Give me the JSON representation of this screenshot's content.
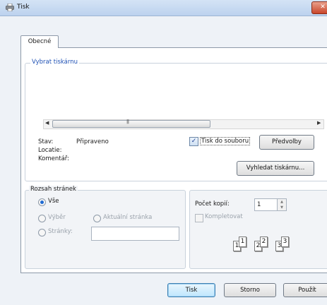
{
  "window": {
    "title": "Tisk",
    "close_symbol": "✕"
  },
  "tabs": [
    {
      "label": "Obecné",
      "selected": true
    }
  ],
  "printer_select": {
    "legend": "Vybrat tiskárnu",
    "scrollbar": {
      "left_arrow": "◀",
      "right_arrow": "▶",
      "grip": "|||"
    },
    "status_label": "Stav:",
    "status_value": "Připraveno",
    "location_label": "Locatie:",
    "location_value": "",
    "comment_label": "Komentář:",
    "comment_value": "",
    "print_to_file": {
      "checked": true,
      "check_mark": "✓",
      "label": "Tisk do souboru"
    },
    "preferences_button": "Předvolby",
    "find_printer_button": "Vyhledat tiskárnu..."
  },
  "page_range": {
    "legend": "Rozsah stránek",
    "options": [
      {
        "label": "Vše",
        "selected": true,
        "enabled": true
      },
      {
        "label": "Výběr",
        "selected": false,
        "enabled": false
      },
      {
        "label": "Aktuální stránka",
        "selected": false,
        "enabled": false
      },
      {
        "label": "Stránky:",
        "selected": false,
        "enabled": false
      }
    ],
    "pages_value": ""
  },
  "copies": {
    "label": "Počet kopií:",
    "value": "1",
    "collate": {
      "label": "Kompletovat",
      "checked": false,
      "enabled": false
    },
    "collate_preview": [
      "1",
      "1",
      "2",
      "2",
      "3",
      "3"
    ]
  },
  "buttons": {
    "print": "Tisk",
    "cancel": "Storno",
    "apply": "Použít"
  },
  "colors": {
    "accent": "#1e50b4",
    "close": "#c9462a",
    "default_button": "#3c7fb1"
  }
}
